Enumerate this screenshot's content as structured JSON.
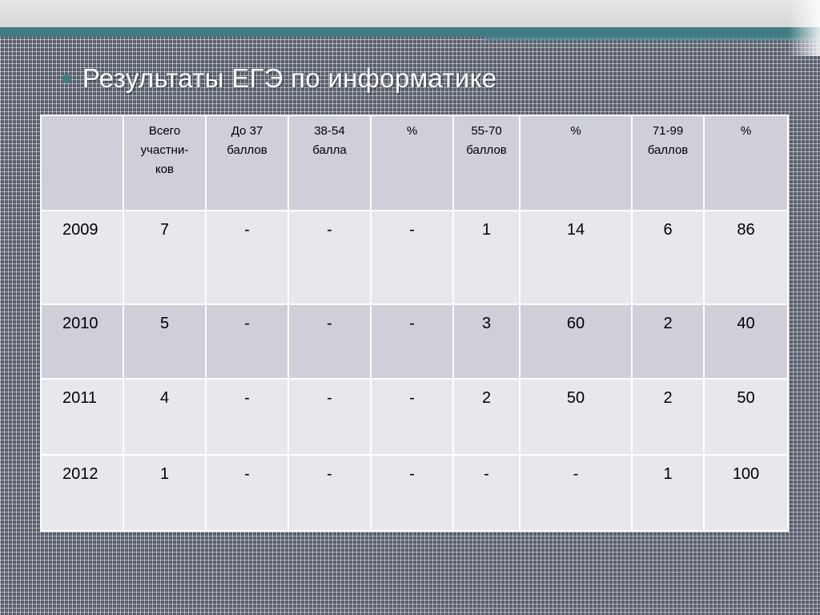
{
  "title": "Результаты  ЕГЭ по информатике",
  "header": [
    "",
    "Всего участни-ков",
    "До 37 баллов",
    "38-54 балла",
    "%",
    "55-70 баллов",
    "%",
    "71-99 баллов",
    "%"
  ],
  "rows": [
    [
      "2009",
      "7",
      "-",
      "-",
      "-",
      "1",
      "14",
      "6",
      "86"
    ],
    [
      "2010",
      "5",
      "-",
      "-",
      "-",
      "3",
      "60",
      "2",
      "40"
    ],
    [
      "2011",
      "4",
      "-",
      "-",
      "-",
      "2",
      "50",
      "2",
      "50"
    ],
    [
      "2012",
      "1",
      "-",
      "-",
      "-",
      "-",
      "-",
      "1",
      "100"
    ]
  ],
  "colors": {
    "accent": "#3f7d82",
    "header_fill": "#cfcfd9",
    "row_light": "#e8e7ed",
    "row_dark": "#cfcfd9"
  }
}
